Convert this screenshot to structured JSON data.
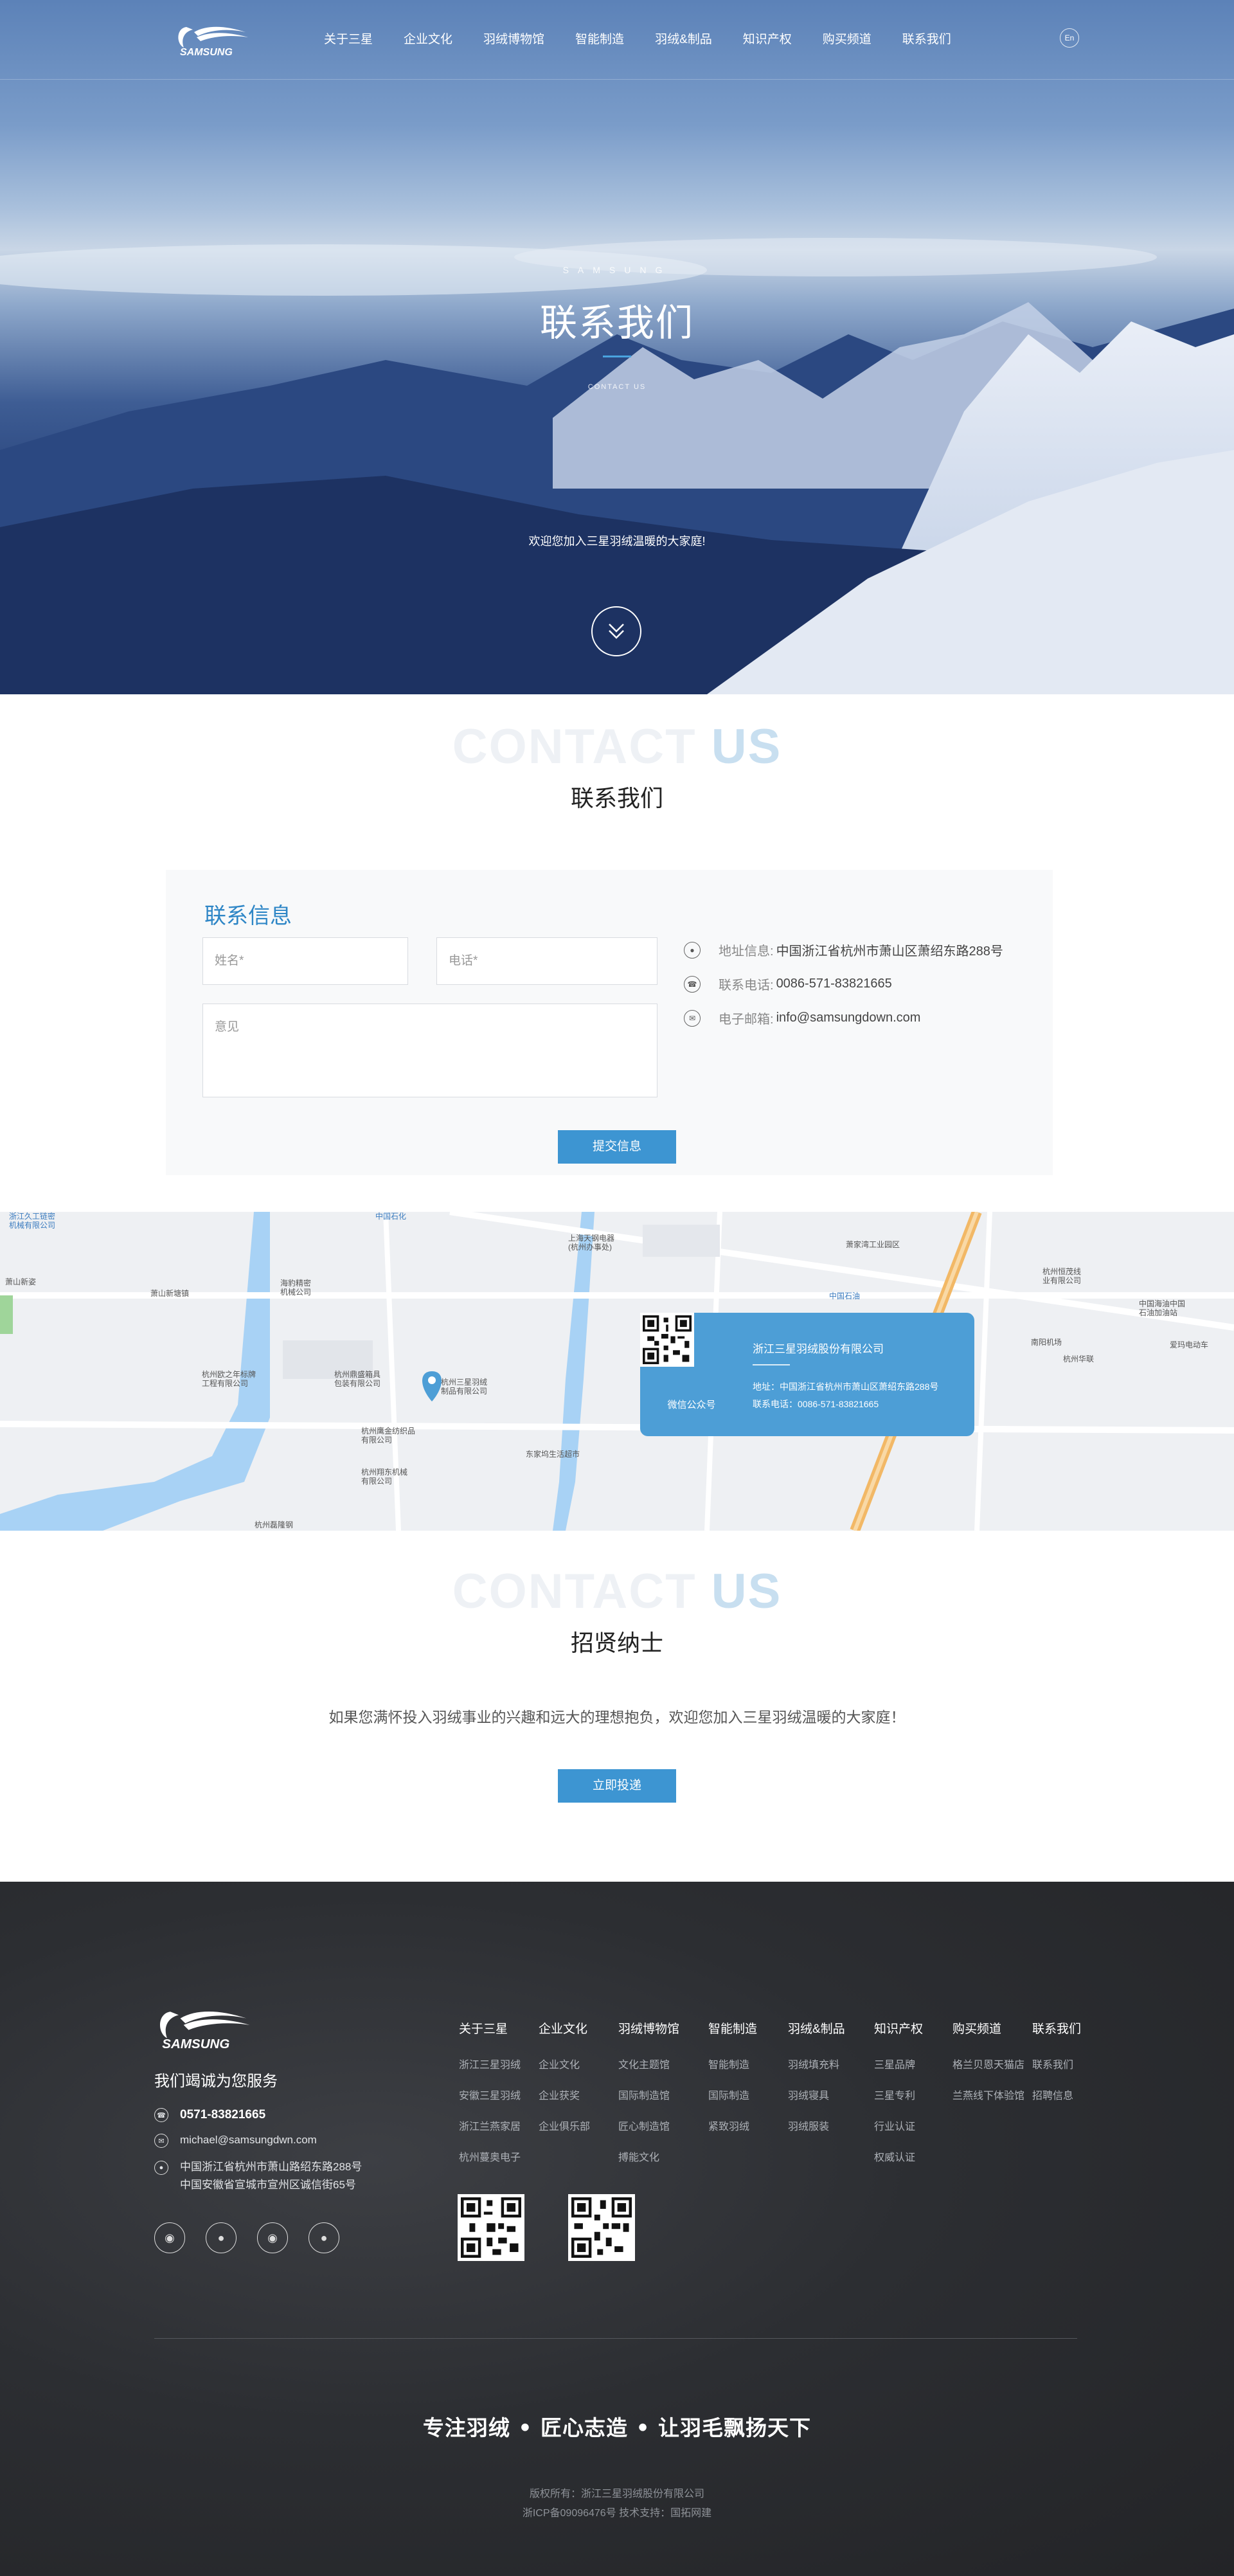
{
  "nav": {
    "items": [
      "关于三星",
      "企业文化",
      "羽绒博物馆",
      "智能制造",
      "羽绒&制品",
      "知识产权",
      "购买频道",
      "联系我们"
    ],
    "lang_label": "En",
    "logo_text": "SAMSUNG"
  },
  "hero": {
    "en_label": "SAMSUNG",
    "title": "联系我们",
    "small_label": "CONTACT US",
    "welcome": "欢迎您加入三星羽绒温暖的大家庭!"
  },
  "contact_section": {
    "en_title_a": "CONTACT",
    "en_title_b": "US",
    "cn_title": "联系我们"
  },
  "form": {
    "title": "联系信息",
    "name_placeholder": "姓名*",
    "phone_placeholder": "电话*",
    "message_placeholder": "意见",
    "submit_label": "提交信息"
  },
  "info": {
    "address_label": "地址信息:",
    "address_value": "中国浙江省杭州市萧山区萧绍东路288号",
    "phone_label": "联系电话:",
    "phone_value": "0086-571-83821665",
    "email_label": "电子邮箱:",
    "email_value": "info@samsungdown.com"
  },
  "map": {
    "labels": [
      {
        "t": "浙江久工链密",
        "s": "机械有限公司"
      },
      {
        "t": "萧山新姿",
        "s": ""
      },
      {
        "t": "中国石化",
        "s": ""
      },
      {
        "t": "上海天钢电器",
        "s": "(杭州办事处)"
      },
      {
        "t": "萧山新塘镇",
        "s": ""
      },
      {
        "t": "海豹精密",
        "s": "机械公司"
      },
      {
        "t": "萧家湾工业园区",
        "s": ""
      },
      {
        "t": "中国石油",
        "s": ""
      },
      {
        "t": "杭州恒茂线",
        "s": "业有限公司"
      },
      {
        "t": "中国海油中国",
        "s": "石油加油站"
      },
      {
        "t": "杭州欧之年标牌",
        "s": "工程有限公司"
      },
      {
        "t": "杭州鼎盛箱具",
        "s": "包装有限公司"
      },
      {
        "t": "杭州三星羽绒",
        "s": "制品有限公司"
      },
      {
        "t": "杭州鹰金纺织品",
        "s": "有限公司"
      },
      {
        "t": "杭州翔东机械",
        "s": "有限公司"
      },
      {
        "t": "东家坞生活超市",
        "s": ""
      },
      {
        "t": "杭州磊隆钢",
        "s": ""
      },
      {
        "t": "南阳机场",
        "s": ""
      },
      {
        "t": "杭州华联",
        "s": ""
      },
      {
        "t": "爱玛电动车",
        "s": ""
      }
    ],
    "card_company": "浙江三星羽绒股份有限公司",
    "card_address": "地址：中国浙江省杭州市萧山区萧绍东路288号",
    "card_phone": "联系电话：0086-571-83821665",
    "qr_caption": "微信公众号"
  },
  "recruit": {
    "en_title_a": "CONTACT",
    "en_title_b": "US",
    "cn_title": "招贤纳士",
    "text": "如果您满怀投入羽绒事业的兴趣和远大的理想抱负，欢迎您加入三星羽绒温暖的大家庭！",
    "apply_label": "立即投递"
  },
  "footer": {
    "logo_text": "SAMSUNG",
    "slogan": "我们竭诚为您服务",
    "phone": "0571-83821665",
    "email": "michael@samsungdwn.com",
    "address_1": "中国浙江省杭州市萧山路绍东路288号",
    "address_2": "中国安徽省宣城市宣州区诚信街65号",
    "columns": [
      {
        "title": "关于三星",
        "items": [
          "浙江三星羽绒",
          "安徽三星羽绒",
          "浙江兰燕家居",
          "杭州蔓奥电子"
        ]
      },
      {
        "title": "企业文化",
        "items": [
          "企业文化",
          "企业获奖",
          "企业俱乐部"
        ]
      },
      {
        "title": "羽绒博物馆",
        "items": [
          "文化主题馆",
          "国际制造馆",
          "匠心制造馆",
          "搏能文化"
        ]
      },
      {
        "title": "智能制造",
        "items": [
          "智能制造",
          "国际制造",
          "紧致羽绒"
        ]
      },
      {
        "title": "羽绒&制品",
        "items": [
          "羽绒填充料",
          "羽绒寝具",
          "羽绒服装"
        ]
      },
      {
        "title": "知识产权",
        "items": [
          "三星品牌",
          "三星专利",
          "行业认证",
          "权威认证"
        ]
      },
      {
        "title": "购买频道",
        "items": [
          "格兰贝恩天猫店",
          "兰燕线下体验馆"
        ]
      },
      {
        "title": "联系我们",
        "items": [
          "联系我们",
          "招聘信息"
        ]
      }
    ],
    "motto": "专注羽绒 • 匠心志造 • 让羽毛飘扬天下",
    "copyright": "版权所有：浙江三星羽绒股份有限公司",
    "icp": "浙ICP备09096476号 技术支持：国拓网建"
  }
}
